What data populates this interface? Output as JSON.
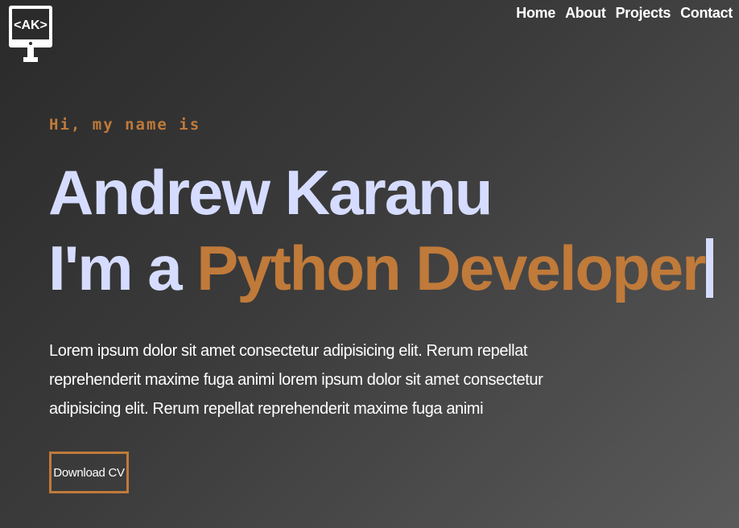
{
  "logo": {
    "text": "<AK>"
  },
  "nav": {
    "items": [
      "Home",
      "About",
      "Projects",
      "Contact"
    ]
  },
  "hero": {
    "intro": "Hi, my name is",
    "name": "Andrew Karanu",
    "role_prefix": "I'm a",
    "role_accent": "Python Developer",
    "description": "Lorem ipsum dolor sit amet consectetur adipisicing elit. Rerum repellat reprehenderit maxime fuga animi lorem ipsum dolor sit amet consectetur adipisicing elit. Rerum repellat reprehenderit maxime fuga animi",
    "cv_button": "Download CV"
  },
  "colors": {
    "accent": "#c07a3a",
    "name": "#d6dcff",
    "text": "#ffffff"
  }
}
